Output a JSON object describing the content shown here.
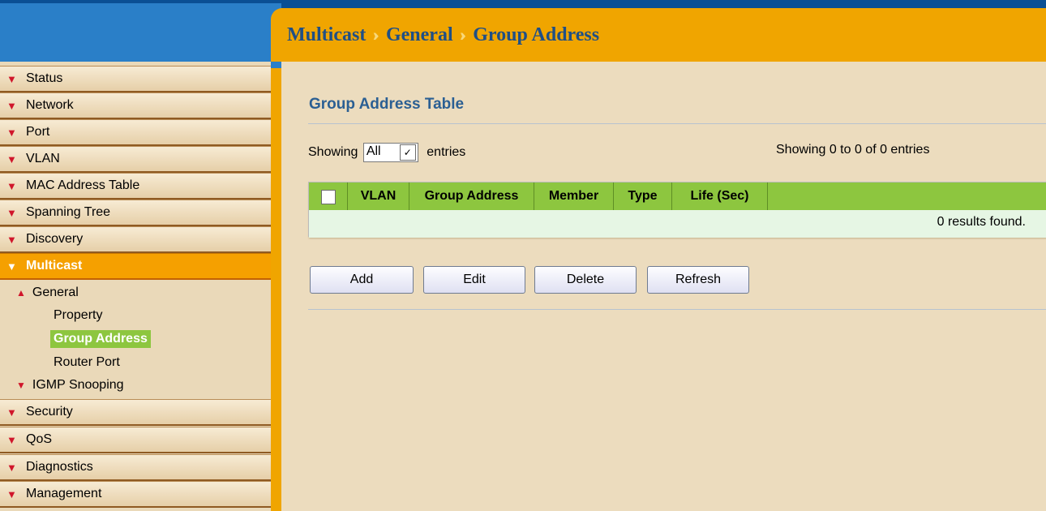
{
  "breadcrumb": [
    "Multicast",
    "General",
    "Group Address"
  ],
  "breadcrumb_separator": "››",
  "sidebar": {
    "items": [
      {
        "label": "Status"
      },
      {
        "label": "Network"
      },
      {
        "label": "Port"
      },
      {
        "label": "VLAN"
      },
      {
        "label": "MAC Address Table"
      },
      {
        "label": "Spanning Tree"
      },
      {
        "label": "Discovery"
      },
      {
        "label": "Multicast",
        "active": true
      },
      {
        "label": "Security"
      },
      {
        "label": "QoS"
      },
      {
        "label": "Diagnostics"
      },
      {
        "label": "Management"
      }
    ],
    "multicast_sub": {
      "general": "General",
      "general_children": [
        "Property",
        "Group Address",
        "Router Port"
      ],
      "selected": "Group Address",
      "igmp": "IGMP Snooping"
    }
  },
  "main": {
    "title": "Group Address Table",
    "showing_prefix": "Showing",
    "entries_select": {
      "value": "All"
    },
    "showing_suffix": "entries",
    "showing_summary": "Showing 0 to 0 of 0 entries",
    "table": {
      "columns": [
        "VLAN",
        "Group Address",
        "Member",
        "Type",
        "Life (Sec)"
      ],
      "empty_message": "0 results found."
    },
    "buttons": {
      "add": "Add",
      "edit": "Edit",
      "delete": "Delete",
      "refresh": "Refresh"
    }
  },
  "colors": {
    "header_orange": "#f0a500",
    "breadcrumb_text": "#1f4f86",
    "table_header_green": "#8dc63f",
    "main_background": "#ecdcbe"
  },
  "icons": {
    "collapsed": "chevron-down-icon",
    "expanded": "chevron-up-icon"
  }
}
